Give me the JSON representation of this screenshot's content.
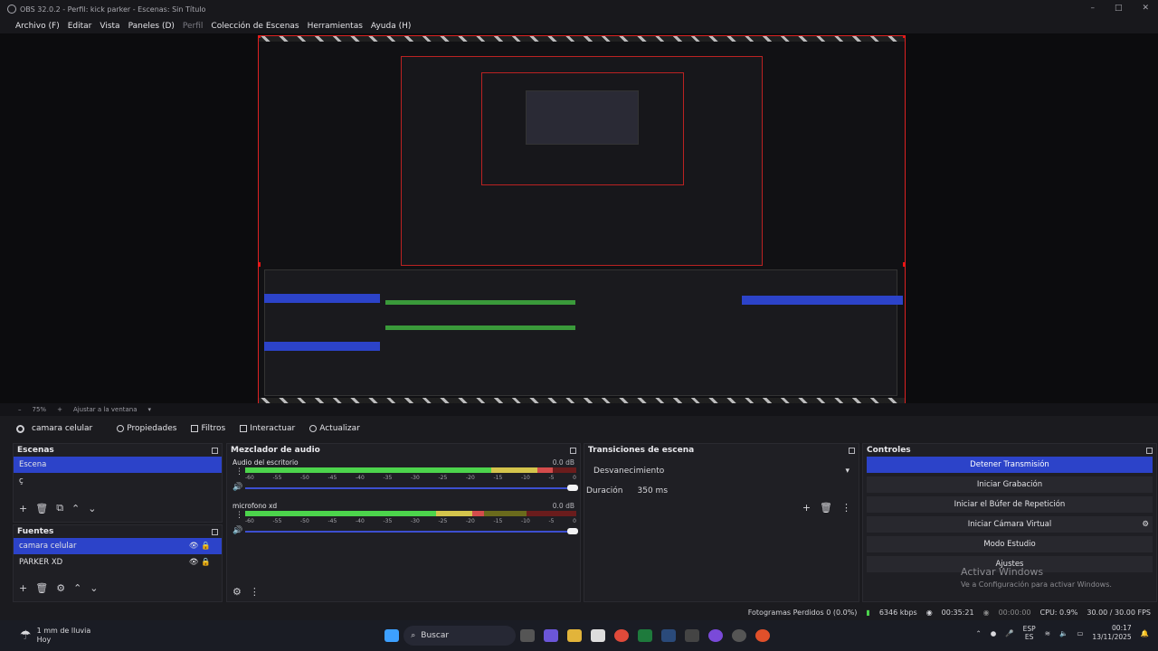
{
  "window": {
    "title": "OBS 32.0.2 - Perfil: kick parker - Escenas: Sin Título",
    "controls": [
      "–",
      "□",
      "✕"
    ]
  },
  "menu": [
    {
      "label": "Archivo (F)",
      "dim": false
    },
    {
      "label": "Editar",
      "dim": false
    },
    {
      "label": "Vista",
      "dim": false
    },
    {
      "label": "Paneles (D)",
      "dim": false
    },
    {
      "label": "Perfil",
      "dim": true
    },
    {
      "label": "Colección de Escenas",
      "dim": false
    },
    {
      "label": "Herramientas",
      "dim": false
    },
    {
      "label": "Ayuda (H)",
      "dim": false
    }
  ],
  "zoom": {
    "minus": "–",
    "value": "75%",
    "plus": "+",
    "fit_label": "Ajustar a la ventana"
  },
  "source_toolbar": {
    "source_name": "camara celular",
    "properties": "Propiedades",
    "filters": "Filtros",
    "interact": "Interactuar",
    "refresh": "Actualizar"
  },
  "scenes": {
    "title": "Escenas",
    "items": [
      "Escena",
      "ç"
    ]
  },
  "sources": {
    "title": "Fuentes",
    "items": [
      {
        "name": "camara celular",
        "selected": true
      },
      {
        "name": "PARKER XD",
        "selected": false
      }
    ]
  },
  "mixer": {
    "title": "Mezclador de audio",
    "ticks": [
      "-60",
      "-55",
      "-50",
      "-45",
      "-40",
      "-35",
      "-30",
      "-25",
      "-20",
      "-15",
      "-10",
      "-5",
      "0"
    ],
    "tracks": [
      {
        "name": "Audio del escritorio",
        "db": "0.0 dB",
        "level": 0.93
      },
      {
        "name": "microfono xd",
        "db": "0.0 dB",
        "level": 0.72
      }
    ]
  },
  "transitions": {
    "title": "Transiciones de escena",
    "selected": "Desvanecimiento",
    "duration_label": "Duración",
    "duration_value": "350 ms"
  },
  "controls": {
    "title": "Controles",
    "buttons": [
      {
        "label": "Detener Transmisión",
        "active": true
      },
      {
        "label": "Iniciar Grabación",
        "active": false
      },
      {
        "label": "Iniciar el Búfer de Repetición",
        "active": false
      },
      {
        "label": "Iniciar Cámara Virtual",
        "active": false
      },
      {
        "label": "Modo Estudio",
        "active": false
      },
      {
        "label": "Ajustes",
        "active": false
      }
    ]
  },
  "watermark": {
    "line1": "Activar Windows",
    "line2": "Ve a Configuración para activar Windows."
  },
  "status": {
    "dropped_frames": "Fotogramas Perdidos 0 (0.0%)",
    "bitrate": "6346 kbps",
    "live_time": "00:35:21",
    "rec_time": "00:00:00",
    "cpu": "CPU: 0.9%",
    "fps": "30.00 / 30.00 FPS"
  },
  "taskbar": {
    "weather_line1": "1 mm de lluvia",
    "weather_line2": "Hoy",
    "search": "Buscar",
    "lang1": "ESP",
    "lang2": "ES",
    "time": "00:17",
    "date": "13/11/2025"
  },
  "colors": {
    "accent": "#2c43c9",
    "preview_border": "#dd2222"
  }
}
